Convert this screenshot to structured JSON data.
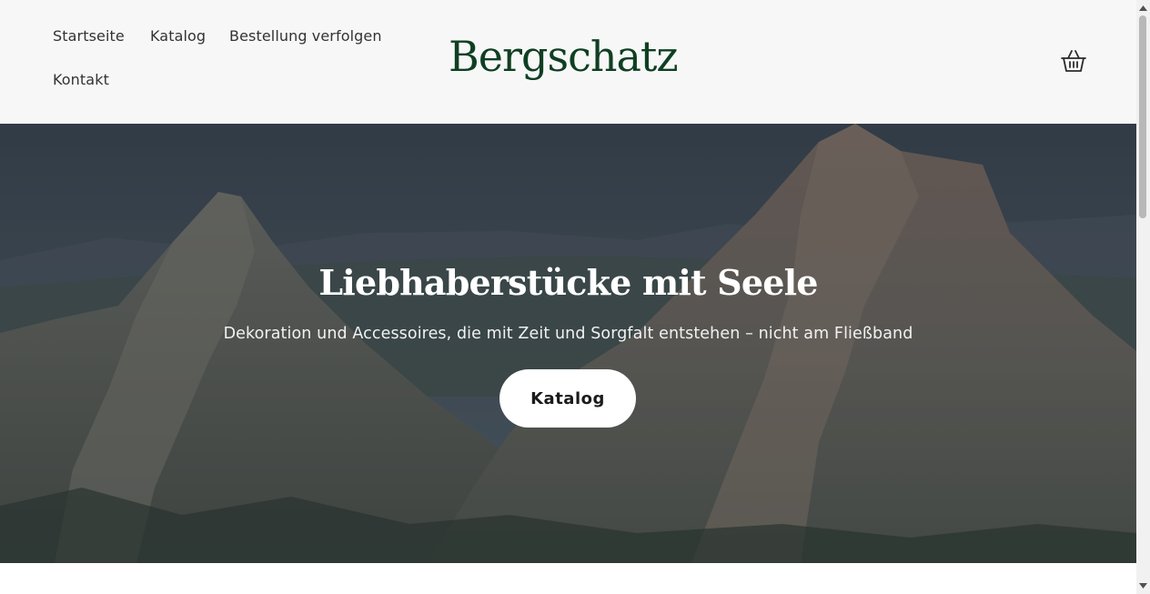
{
  "header": {
    "nav": [
      {
        "label": "Startseite"
      },
      {
        "label": "Katalog"
      },
      {
        "label": "Bestellung verfolgen"
      },
      {
        "label": "Kontakt"
      }
    ],
    "brand": "Bergschatz",
    "cart_icon": "basket-icon"
  },
  "hero": {
    "title": "Liebhaberstücke mit Seele",
    "subtitle": "Dekoration und Accessoires, die mit Zeit und Sorgfalt entstehen – nicht am Fließband",
    "button_label": "Katalog",
    "image": "mountain-landscape"
  },
  "colors": {
    "brand": "#0f3f22",
    "header_bg": "#f7f7f7",
    "nav_text": "#333333",
    "button_bg": "#ffffff"
  }
}
